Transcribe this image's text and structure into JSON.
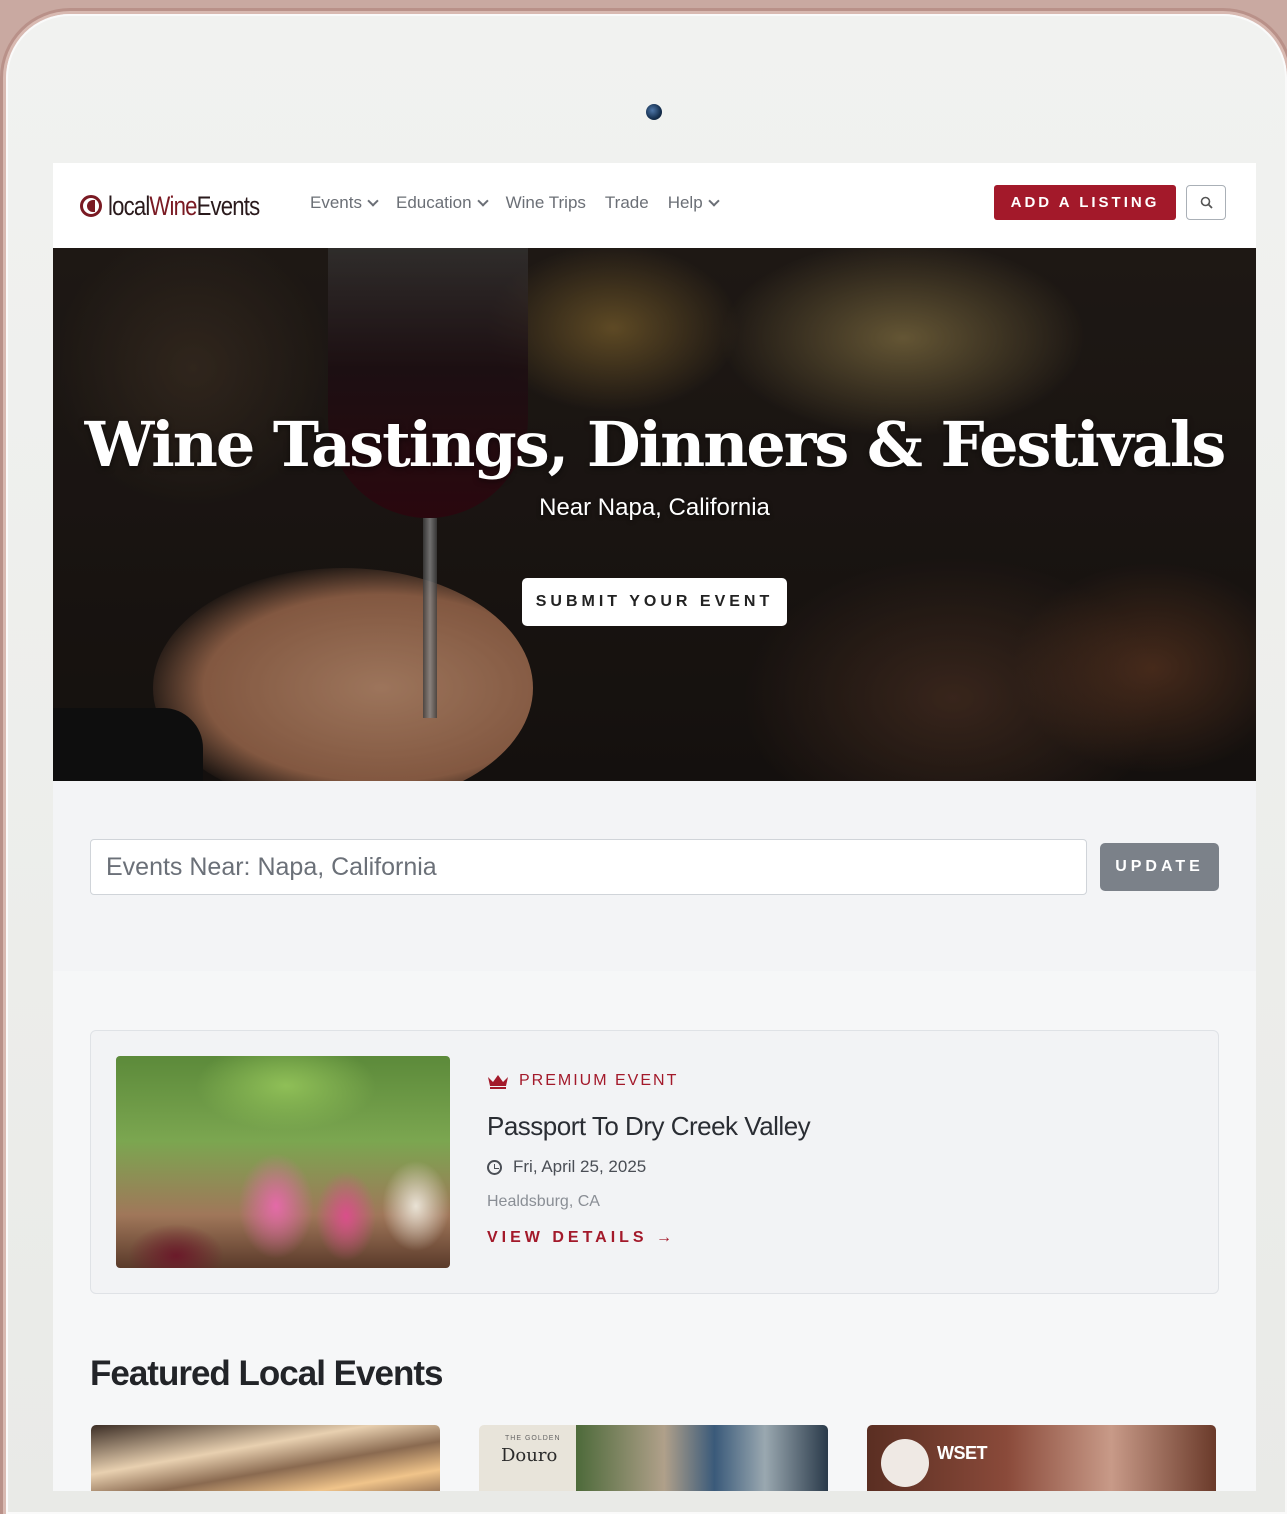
{
  "header": {
    "logo_prefix": "local",
    "logo_wine": "Wine",
    "logo_suffix": "Events",
    "nav": [
      {
        "label": "Events",
        "dropdown": true
      },
      {
        "label": "Education",
        "dropdown": true
      },
      {
        "label": "Wine Trips",
        "dropdown": false
      },
      {
        "label": "Trade",
        "dropdown": false
      },
      {
        "label": "Help",
        "dropdown": true
      }
    ],
    "add_listing_label": "ADD A LISTING"
  },
  "hero": {
    "title": "Wine Tastings, Dinners & Festivals",
    "subtitle": "Near Napa, California",
    "submit_label": "SUBMIT YOUR EVENT"
  },
  "location_search": {
    "value": "Events Near: Napa, California",
    "update_label": "UPDATE"
  },
  "premium_event": {
    "badge": "PREMIUM EVENT",
    "title": "Passport To Dry Creek Valley",
    "date": "Fri, April 25, 2025",
    "location": "Healdsburg, CA",
    "link_label": "VIEW DETAILS →"
  },
  "featured": {
    "heading": "Featured Local Events",
    "card2_small": "THE GOLDEN",
    "card2_label": "Douro",
    "card3_label": "WSET"
  },
  "colors": {
    "brand": "#a3192a",
    "logo": "#7a1a23",
    "update_button": "#7b8189"
  }
}
